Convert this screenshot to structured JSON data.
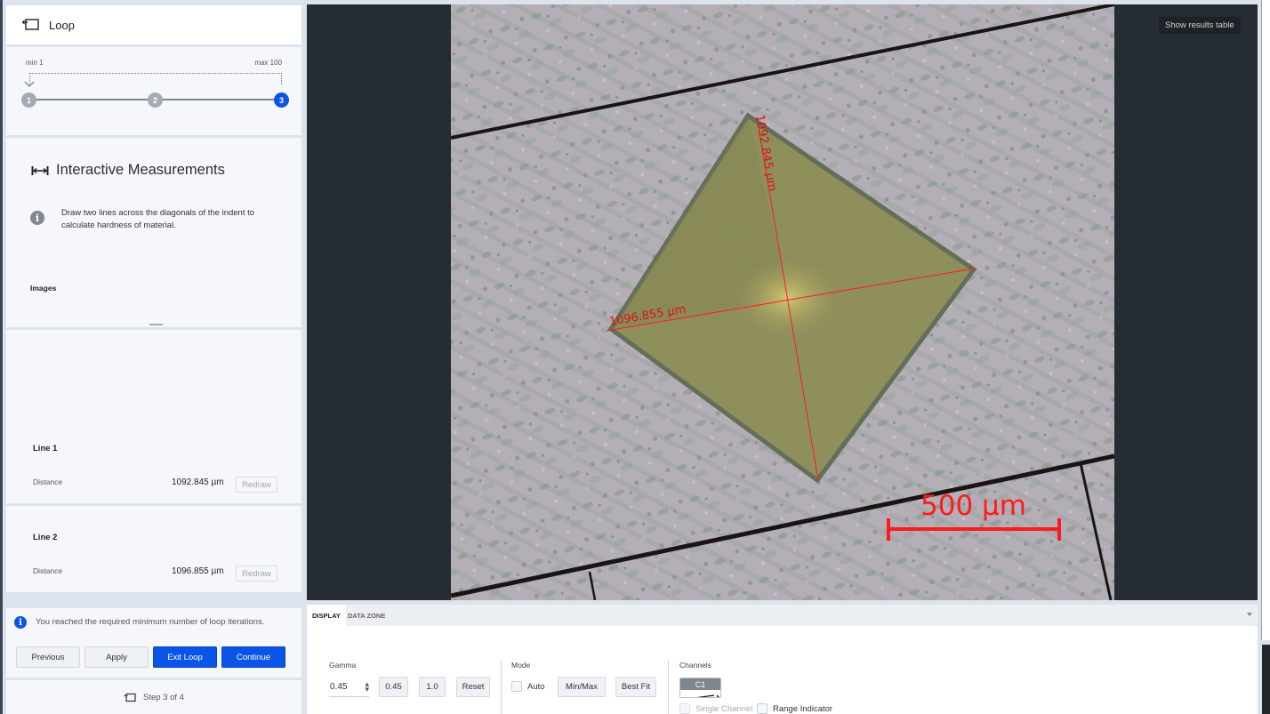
{
  "loop": {
    "title": "Loop",
    "icon": "loop-icon",
    "min_label": "min 1",
    "max_label": "max 100",
    "steps": [
      {
        "label": "1",
        "state": "done"
      },
      {
        "label": "2",
        "state": "done"
      },
      {
        "label": "3",
        "state": "active"
      }
    ]
  },
  "measurements": {
    "heading": "Interactive Measurements",
    "icon": "measure-ruler-icon",
    "description": "Draw two lines across the diagonals of the indent to calculate hardness of material.",
    "images_label": "Images"
  },
  "lines": [
    {
      "title": "Line 1",
      "distance_label": "Distance",
      "distance_value": "1092.845 µm",
      "redraw_label": "Redraw"
    },
    {
      "title": "Line 2",
      "distance_label": "Distance",
      "distance_value": "1096.855 µm",
      "redraw_label": "Redraw"
    }
  ],
  "footer": {
    "notice": "You reached the required minimum number of loop iterations.",
    "buttons": {
      "previous": "Previous",
      "apply": "Apply",
      "exit_loop": "Exit Loop",
      "continue": "Continue"
    },
    "step_text": "Step 3 of 4"
  },
  "viewer": {
    "show_results_label": "Show results table",
    "scale_bar_label": "500 µm",
    "measurement_labels": {
      "line1": "1092.845 µm",
      "line2": "1096.855 µm"
    },
    "annotation_color": "#ff1a1a"
  },
  "bottom_panel": {
    "tabs": [
      {
        "label": "DISPLAY",
        "active": true
      },
      {
        "label": "DATA ZONE",
        "active": false
      }
    ],
    "gamma": {
      "label": "Gamma",
      "value": "0.45",
      "preset1": "0.45",
      "preset2": "1.0",
      "reset": "Reset"
    },
    "mode": {
      "label": "Mode",
      "auto_label": "Auto",
      "auto_checked": false,
      "minmax": "Min/Max",
      "bestfit": "Best Fit"
    },
    "channels": {
      "label": "Channels",
      "chip": "C1",
      "single_channel": "Single Channel",
      "single_channel_checked": false,
      "range_indicator": "Range Indicator",
      "range_indicator_checked": false
    }
  },
  "colors": {
    "primary": "#0a55e8",
    "viewer_bg": "#262c33",
    "annotation": "#ff1a1a"
  }
}
